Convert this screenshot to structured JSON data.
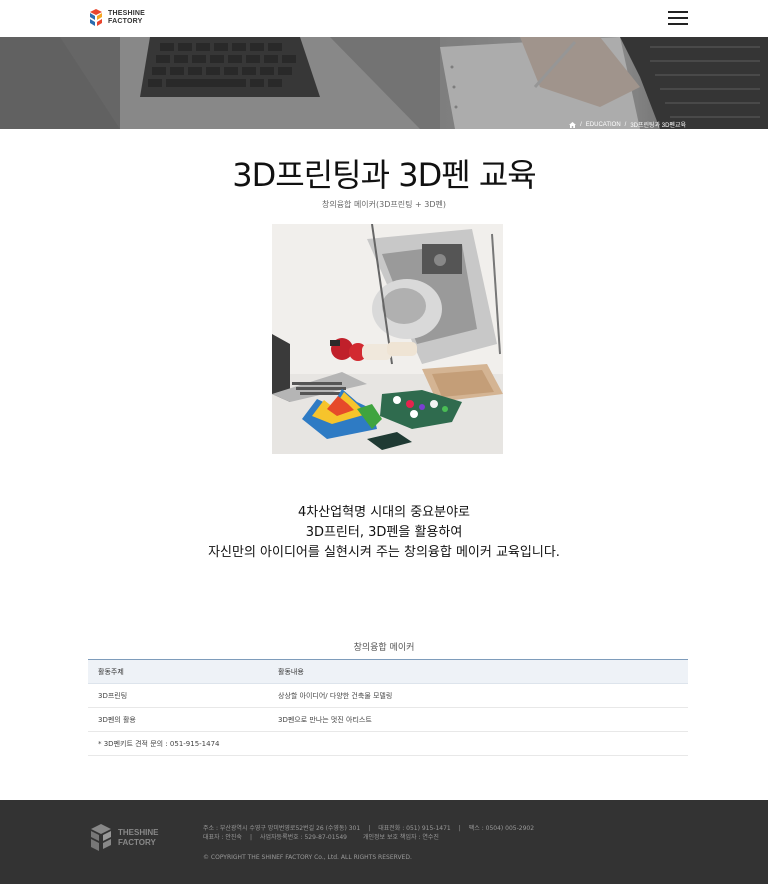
{
  "header": {
    "logo_line1": "THESHINE",
    "logo_line2": "FACTORY",
    "menu_icon": "hamburger-menu-icon"
  },
  "breadcrumb": {
    "home_icon": "home-icon",
    "items": [
      "EDUCATION",
      "3D프린팅과 3D펜교육"
    ]
  },
  "page": {
    "title": "3D프린팅과 3D펜 교육",
    "subtitle": "창의융합 메이커(3D프린팅 + 3D펜)"
  },
  "intro": {
    "lines": [
      "4차산업혁명 시대의 중요분야로",
      "3D프린터, 3D펜을 활용하여",
      "자신만의 아이디어를 실현시켜 주는 창의융합 메이커 교육입니다."
    ]
  },
  "table": {
    "caption": "창의융합 메이커",
    "headers": [
      "활동주제",
      "활동내용"
    ],
    "rows": [
      [
        "3D프린팅",
        "상상할 아이디어/ 다양한 건축물 모델링"
      ],
      [
        "3D펜의 활용",
        "3D펜으로 만나는 멋진 아티스트"
      ]
    ],
    "note": "* 3D펜키트 견적 문의 : 051-915-1474"
  },
  "footer": {
    "logo_line1": "THESHINE",
    "logo_line2": "FACTORY",
    "address": "주소 : 부산광역시 수영구 망미번영로52번길 26 (수영동) 301",
    "phone": "대표전화 : 051) 915-1471",
    "fax": "팩스 : 0504) 005-2902",
    "ceo": "대표자 : 안진숙",
    "biz_no": "사업자등록번호 : 529-87-01549",
    "privacy": "개인정보 보호 책임자 : 연수진",
    "copyright": "© COPYRIGHT THE SHINEF FACTORY Co., Ltd. ALL RIGHTS RESERVED."
  },
  "colors": {
    "logo_red": "#e8442d",
    "logo_blue": "#2b6cb0",
    "table_header_bg": "#eef2f7",
    "table_header_border": "#7e9cbb",
    "footer_bg": "#333333"
  }
}
